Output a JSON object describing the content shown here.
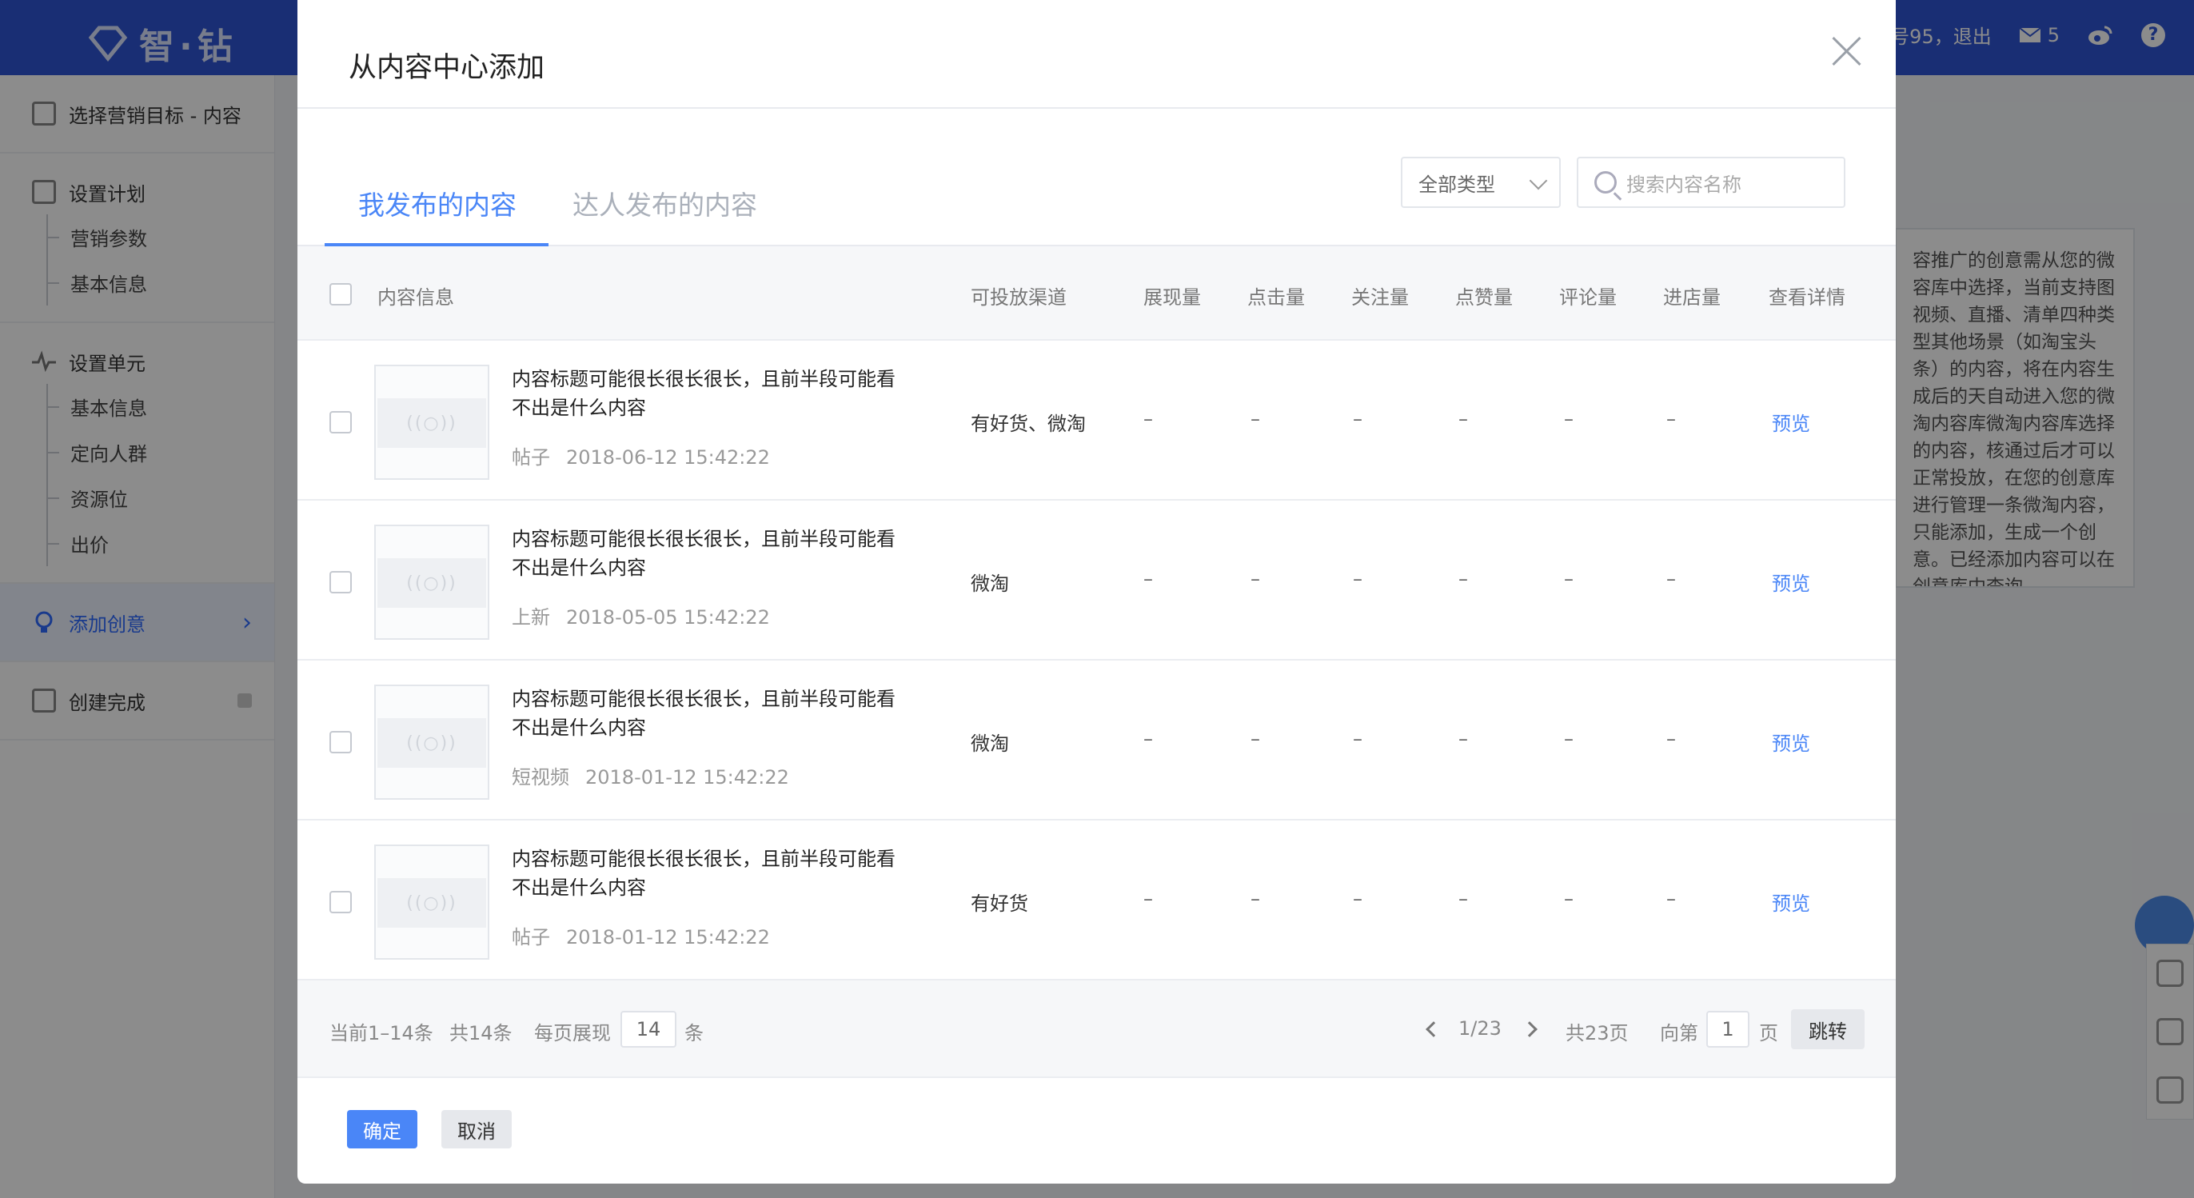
{
  "app": {
    "logo_text": "智·钻",
    "user_suffix": "号95，退出",
    "mail_count": "5"
  },
  "sidebar": {
    "goal": "选择营销目标 - 内容",
    "plan": {
      "title": "设置计划",
      "items": [
        "营销参数",
        "基本信息"
      ]
    },
    "unit": {
      "title": "设置单元",
      "items": [
        "基本信息",
        "定向人群",
        "资源位",
        "出价"
      ]
    },
    "creative": "添加创意",
    "done": "创建完成"
  },
  "help_text": "容推广的创意需从您的微容库中选择，当前支持图视频、直播、清单四种类型其他场景（如淘宝头条）的内容，将在内容生成后的天自动进入您的微淘内容库微淘内容库选择的内容，核通过后才可以正常投放，在您的创意库进行管理一条微淘内容，只能添加，生成一个创意。已经添加内容可以在创意库中查询",
  "modal": {
    "title": "从内容中心添加",
    "tabs": [
      "我发布的内容",
      "达人发布的内容"
    ],
    "type_select": "全部类型",
    "search_placeholder": "搜索内容名称",
    "columns": [
      "内容信息",
      "可投放渠道",
      "展现量",
      "点击量",
      "关注量",
      "点赞量",
      "评论量",
      "进店量",
      "查看详情"
    ],
    "rows": [
      {
        "title": "内容标题可能很长很长很长，且前半段可能看不出是什么内容",
        "type": "帖子",
        "time": "2018-06-12 15:42:22",
        "channel": "有好货、微淘",
        "impressions": "–",
        "clicks": "–",
        "follows": "–",
        "likes": "–",
        "comments": "–",
        "visits": "–",
        "detail": "预览"
      },
      {
        "title": "内容标题可能很长很长很长，且前半段可能看不出是什么内容",
        "type": "上新",
        "time": "2018-05-05 15:42:22",
        "channel": "微淘",
        "impressions": "–",
        "clicks": "–",
        "follows": "–",
        "likes": "–",
        "comments": "–",
        "visits": "–",
        "detail": "预览"
      },
      {
        "title": "内容标题可能很长很长很长，且前半段可能看不出是什么内容",
        "type": "短视频",
        "time": "2018-01-12 15:42:22",
        "channel": "微淘",
        "impressions": "–",
        "clicks": "–",
        "follows": "–",
        "likes": "–",
        "comments": "–",
        "visits": "–",
        "detail": "预览"
      },
      {
        "title": "内容标题可能很长很长很长，且前半段可能看不出是什么内容",
        "type": "帖子",
        "time": "2018-01-12 15:42:22",
        "channel": "有好货",
        "impressions": "–",
        "clicks": "–",
        "follows": "–",
        "likes": "–",
        "comments": "–",
        "visits": "–",
        "detail": "预览"
      }
    ],
    "pagination": {
      "range": "当前1–14条",
      "total": "共14条",
      "per_page_label": "每页展现",
      "per_page": "14",
      "per_page_unit": "条",
      "page": "1/23",
      "pages_total": "共23页",
      "goto_label": "向第",
      "goto_value": "1",
      "goto_unit": "页",
      "jump": "跳转"
    },
    "confirm": "确定",
    "cancel": "取消"
  }
}
